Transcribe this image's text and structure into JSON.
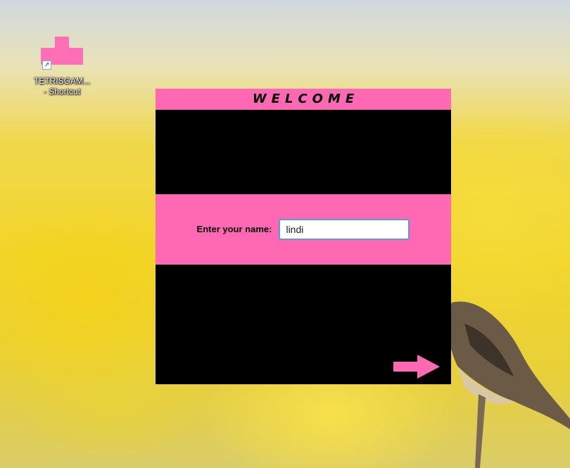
{
  "desktop": {
    "shortcut": {
      "label_line1": "TETRISGAM...",
      "label_line2": "- Shortcut",
      "icon": "tetris-block-icon"
    }
  },
  "window": {
    "title": "WELCOME",
    "name_prompt": "Enter your name:",
    "name_value": "lindi",
    "next_icon": "arrow-right-icon"
  },
  "colors": {
    "accent": "#ff69b4",
    "panel": "#000000",
    "input_border": "#5b9bd5"
  }
}
